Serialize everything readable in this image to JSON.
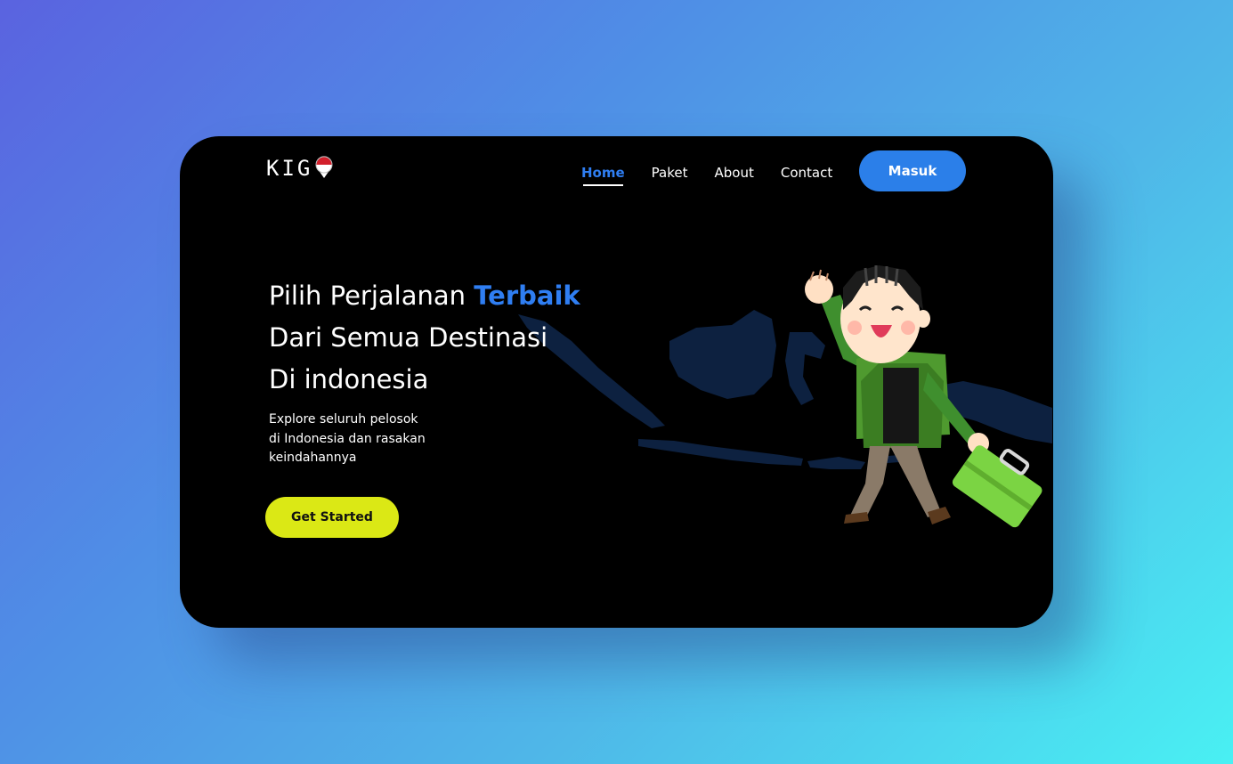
{
  "brand": {
    "logo_text": "KIG",
    "logo_pin_icon": "indonesia-pin-icon"
  },
  "nav": {
    "items": [
      {
        "label": "Home",
        "active": true
      },
      {
        "label": "Paket",
        "active": false
      },
      {
        "label": "About",
        "active": false
      },
      {
        "label": "Contact",
        "active": false
      }
    ],
    "login_label": "Masuk"
  },
  "hero": {
    "title_line1_prefix": "Pilih Perjalanan ",
    "title_line1_highlight": "Terbaik",
    "title_line2": "Dari Semua Destinasi",
    "title_line3": "Di indonesia",
    "subtitle_line1": "Explore seluruh pelosok",
    "subtitle_line2": "di Indonesia dan rasakan",
    "subtitle_line3": "keindahannya",
    "cta_label": "Get Started"
  },
  "colors": {
    "accent_blue": "#2b7fe9",
    "cta_yellow": "#dbe815",
    "card_bg": "#000000",
    "map_fill": "#0d2140"
  },
  "illustration": {
    "map_icon": "indonesia-map-icon",
    "traveler_icon": "traveler-with-suitcase-icon"
  }
}
